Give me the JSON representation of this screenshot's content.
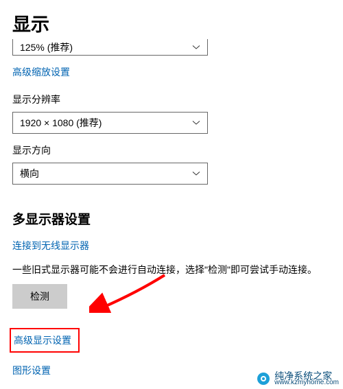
{
  "header": {
    "title": "显示"
  },
  "scale": {
    "value": "125% (推荐)"
  },
  "links": {
    "advanced_scale": "高级缩放设置",
    "wireless_display": "连接到无线显示器",
    "advanced_display": "高级显示设置",
    "graphics": "图形设置"
  },
  "labels": {
    "resolution": "显示分辨率",
    "orientation": "显示方向"
  },
  "resolution": {
    "value": "1920 × 1080 (推荐)"
  },
  "orientation": {
    "value": "横向"
  },
  "multi_display": {
    "title": "多显示器设置",
    "description": "一些旧式显示器可能不会进行自动连接，选择\"检测\"即可尝试手动连接。",
    "detect_button": "检测"
  },
  "watermark": {
    "name": "纯净系统之家",
    "url": "www.kzmyhome.com"
  }
}
